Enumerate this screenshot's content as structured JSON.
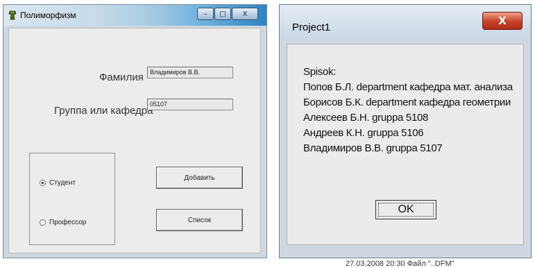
{
  "window_left": {
    "title": "Полиморфизм",
    "icon": "app-icon",
    "controls": {
      "minimize": "–",
      "maximize": "□",
      "close": "X"
    },
    "fields": {
      "surname_label": "Фамилия",
      "surname_value": "Владимиров В.В.",
      "group_label": "Группа или кафедра",
      "group_value": "05107"
    },
    "radios": [
      {
        "label": "Студент",
        "checked": true
      },
      {
        "label": "Профессор",
        "checked": false
      }
    ],
    "buttons": {
      "add": "Добавить",
      "list": "Список"
    }
  },
  "window_right": {
    "title": "Project1",
    "close": "X",
    "message_lines": [
      "Spisok:",
      "Попов Б.Л. department кафедра мат. анализа",
      "Борисов Б.К. department кафедра геометрии",
      "Алексеев Б.Н. gruppa 5108",
      "Андреев К.Н. gruppa 5106",
      "Владимиров В.В. gruppa 5107"
    ],
    "ok": "OK"
  },
  "background_text": "27.03.2008 20:30    Файл \"..DFM\""
}
